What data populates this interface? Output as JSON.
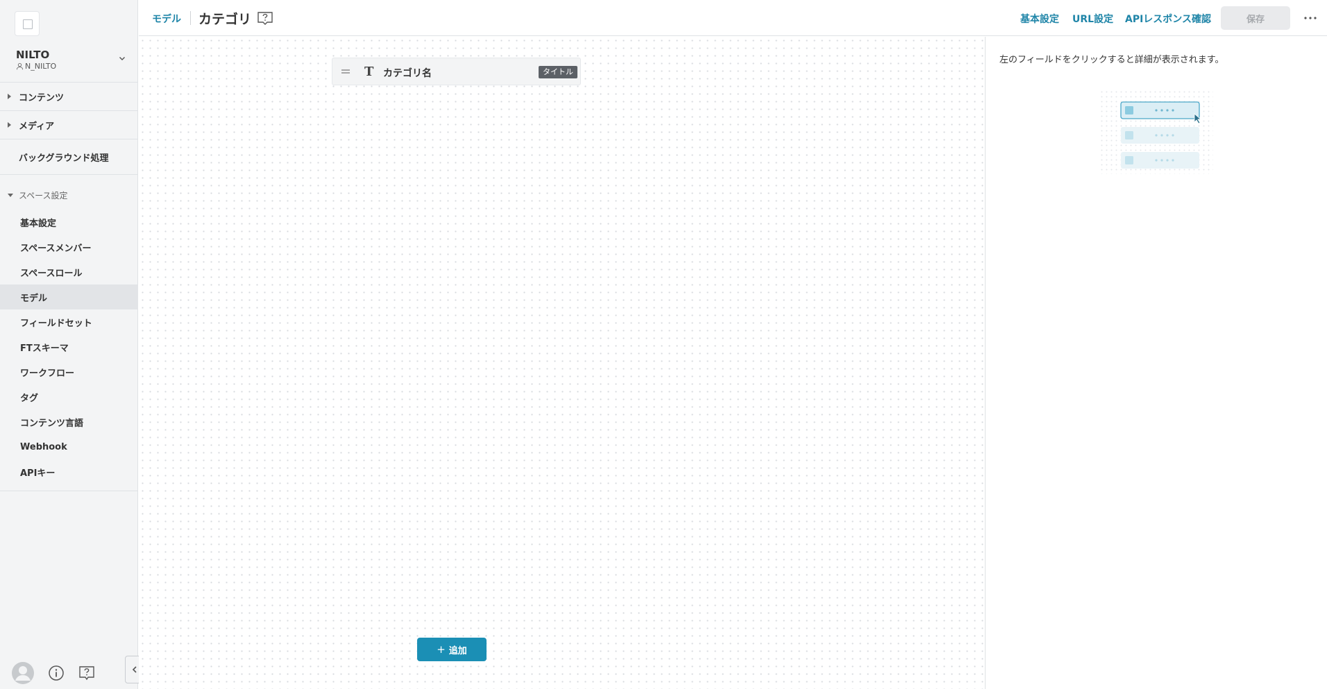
{
  "sidebar": {
    "space_name": "NILTO",
    "space_user": "N_NILTO",
    "nav": {
      "contents": "コンテンツ",
      "media": "メディア",
      "background": "バックグラウンド処理",
      "space_settings": "スペース設定"
    },
    "settings_items": [
      {
        "label": "基本設定",
        "active": false
      },
      {
        "label": "スペースメンバー",
        "active": false
      },
      {
        "label": "スペースロール",
        "active": false
      },
      {
        "label": "モデル",
        "active": true
      },
      {
        "label": "フィールドセット",
        "active": false
      },
      {
        "label": "FTスキーマ",
        "active": false
      },
      {
        "label": "ワークフロー",
        "active": false
      },
      {
        "label": "タグ",
        "active": false
      },
      {
        "label": "コンテンツ言語",
        "active": false
      },
      {
        "label": "Webhook",
        "active": false
      },
      {
        "label": "APIキー",
        "active": false
      }
    ],
    "footer_icons": [
      "avatar-icon",
      "info-icon",
      "help-icon"
    ]
  },
  "header": {
    "breadcrumb_model": "モデル",
    "title": "カテゴリ",
    "links": {
      "basic": "基本設定",
      "url": "URL設定",
      "api": "APIレスポンス確認"
    },
    "save_label": "保存"
  },
  "canvas": {
    "field": {
      "type_glyph": "T",
      "name": "カテゴリ名",
      "badge": "タイトル"
    },
    "add_label": "追加",
    "add_glyph": "+"
  },
  "panel": {
    "hint": "左のフィールドをクリックすると詳細が表示されます。"
  },
  "colors": {
    "accent": "#1f85a8",
    "add_button": "#1b8fb5",
    "sidebar_bg": "#f3f4f5",
    "badge_bg": "#5c6066"
  }
}
